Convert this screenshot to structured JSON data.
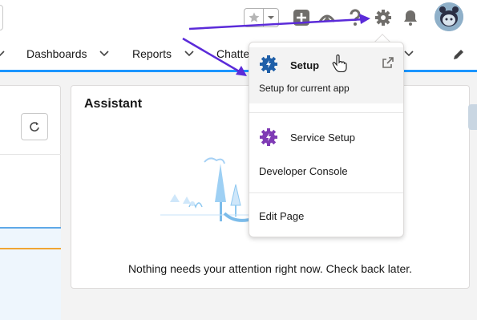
{
  "header": {
    "favorites_star_icon": "star-icon",
    "favorites_dropdown_icon": "chevron-down-icon",
    "icons": [
      "plus-icon",
      "trailhead-icon",
      "help-icon",
      "gear-icon",
      "bell-icon"
    ],
    "avatar": "avatar"
  },
  "nav": {
    "items": [
      {
        "label": "Dashboards"
      },
      {
        "label": "Reports"
      },
      {
        "label": "Chatter"
      }
    ],
    "edit_icon": "pencil-icon"
  },
  "assistant": {
    "title": "Assistant",
    "empty_message": "Nothing needs your attention right now. Check back later."
  },
  "setup_menu": {
    "setup_title": "Setup",
    "setup_subtitle": "Setup for current app",
    "service_setup": "Service Setup",
    "developer_console": "Developer Console",
    "edit_page": "Edit Page"
  },
  "colors": {
    "brand_blue": "#1b96ff",
    "setup_gear": "#1f5fa8",
    "service_gear": "#7f3bb5",
    "annotation_arrow": "#5b2bd9"
  }
}
